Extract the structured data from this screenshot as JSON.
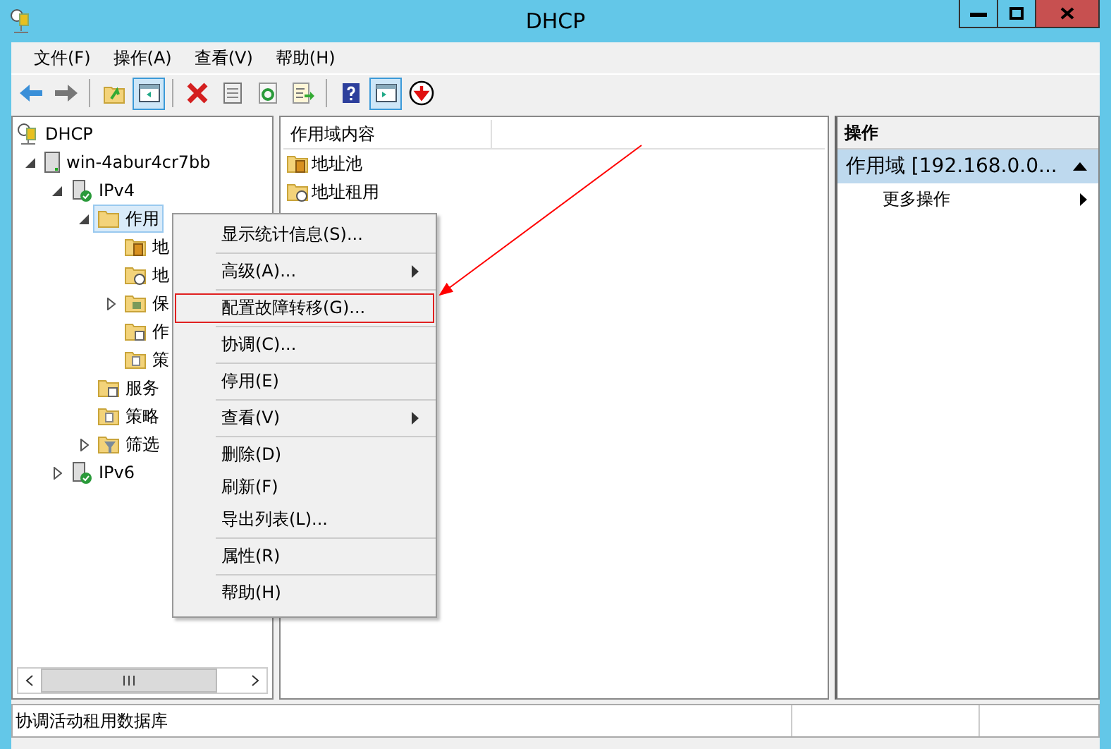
{
  "window": {
    "title": "DHCP"
  },
  "menu_bar": [
    "文件(F)",
    "操作(A)",
    "查看(V)",
    "帮助(H)"
  ],
  "toolbar": [
    [
      {
        "kind": "back",
        "selected": false
      },
      {
        "kind": "forward",
        "selected": false
      }
    ],
    [
      {
        "kind": "up",
        "selected": false
      },
      {
        "kind": "tree-pane",
        "selected": true
      }
    ],
    [
      {
        "kind": "delete",
        "selected": false
      },
      {
        "kind": "properties",
        "selected": false
      },
      {
        "kind": "refresh",
        "selected": false
      },
      {
        "kind": "export",
        "selected": false
      }
    ],
    [
      {
        "kind": "help",
        "selected": false
      },
      {
        "kind": "action-pane",
        "selected": true
      },
      {
        "kind": "download",
        "selected": false
      }
    ]
  ],
  "tree": [
    {
      "label": "DHCP",
      "kind": "dhcp",
      "selected": false,
      "children": [
        {
          "label": "win-4abur4cr7bb",
          "kind": "server",
          "expanded": true,
          "selected": false,
          "children": [
            {
              "label": "IPv4",
              "kind": "ipserver",
              "expanded": true,
              "selected": false,
              "children": [
                {
                  "label": "作用",
                  "kind": "folder",
                  "expanded": true,
                  "selected": true,
                  "children": [
                    {
                      "label": "地",
                      "kind": "pool",
                      "selected": false
                    },
                    {
                      "label": "地",
                      "kind": "lease",
                      "selected": false
                    },
                    {
                      "label": "保",
                      "kind": "reserve",
                      "expanded": false,
                      "selected": false
                    },
                    {
                      "label": "作",
                      "kind": "options",
                      "selected": false
                    },
                    {
                      "label": "策",
                      "kind": "policy",
                      "selected": false
                    }
                  ]
                },
                {
                  "label": "服务",
                  "kind": "options",
                  "selected": false
                },
                {
                  "label": "策略",
                  "kind": "policy",
                  "selected": false
                },
                {
                  "label": "筛选",
                  "kind": "filter",
                  "expanded": false,
                  "selected": false
                }
              ]
            },
            {
              "label": "IPv6",
              "kind": "ipserver",
              "expanded": false,
              "selected": false
            }
          ]
        }
      ]
    }
  ],
  "content": {
    "column": "作用域内容",
    "items": [
      {
        "label": "地址池",
        "kind": "pool"
      },
      {
        "label": "地址租用",
        "kind": "lease"
      }
    ]
  },
  "actions": {
    "header": "操作",
    "section": "作用域 [192.168.0.0...",
    "items": [
      {
        "label": "更多操作"
      }
    ]
  },
  "context_menu": [
    [
      {
        "label": "显示统计信息(S)...",
        "submenu": false,
        "highlighted": false
      }
    ],
    [
      {
        "label": "高级(A)...",
        "submenu": true,
        "highlighted": false
      }
    ],
    [
      {
        "label": "配置故障转移(G)...",
        "submenu": false,
        "highlighted": true
      }
    ],
    [
      {
        "label": "协调(C)...",
        "submenu": false,
        "highlighted": false
      }
    ],
    [
      {
        "label": "停用(E)",
        "submenu": false,
        "highlighted": false
      }
    ],
    [
      {
        "label": "查看(V)",
        "submenu": true,
        "highlighted": false
      }
    ],
    [
      {
        "label": "删除(D)",
        "submenu": false,
        "highlighted": false
      },
      {
        "label": "刷新(F)",
        "submenu": false,
        "highlighted": false
      },
      {
        "label": "导出列表(L)...",
        "submenu": false,
        "highlighted": false
      }
    ],
    [
      {
        "label": "属性(R)",
        "submenu": false,
        "highlighted": false
      }
    ],
    [
      {
        "label": "帮助(H)",
        "submenu": false,
        "highlighted": false
      }
    ]
  ],
  "status_bar": {
    "text": "协调活动租用数据库"
  }
}
